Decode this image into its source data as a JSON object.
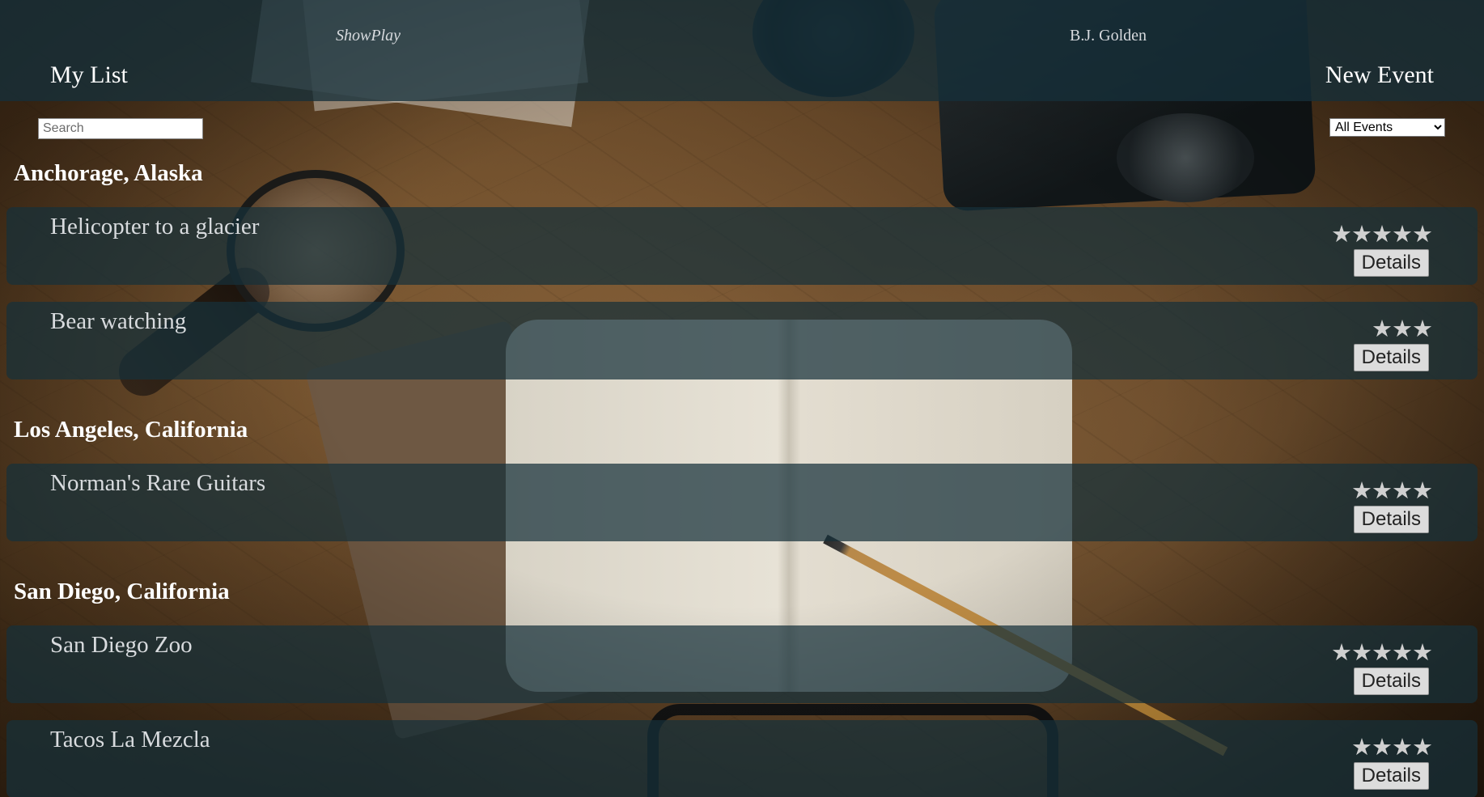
{
  "header": {
    "brand": "ShowPlay",
    "user_name": "B.J. Golden",
    "my_list_label": "My List",
    "new_event_label": "New Event"
  },
  "search": {
    "placeholder": "Search",
    "value": ""
  },
  "filter": {
    "selected": "All Events"
  },
  "groups": [
    {
      "city": "Anchorage, Alaska",
      "events": [
        {
          "title": "Helicopter to a glacier",
          "stars": "★★★★★",
          "rating": 5,
          "details_label": "Details"
        },
        {
          "title": "Bear watching",
          "stars": "★★★",
          "rating": 3,
          "details_label": "Details"
        }
      ]
    },
    {
      "city": "Los Angeles, California",
      "events": [
        {
          "title": "Norman's Rare Guitars",
          "stars": "★★★★",
          "rating": 4,
          "details_label": "Details"
        }
      ]
    },
    {
      "city": "San Diego, California",
      "events": [
        {
          "title": "San Diego Zoo",
          "stars": "★★★★★",
          "rating": 5,
          "details_label": "Details"
        },
        {
          "title": "Tacos La Mezcla",
          "stars": "★★★★",
          "rating": 4,
          "details_label": "Details"
        }
      ]
    }
  ],
  "colors": {
    "overlay": "#16303A",
    "heading_text": "#FFFFFF",
    "event_text": "#D8DBDE",
    "button_bg": "#DCDCDC"
  }
}
